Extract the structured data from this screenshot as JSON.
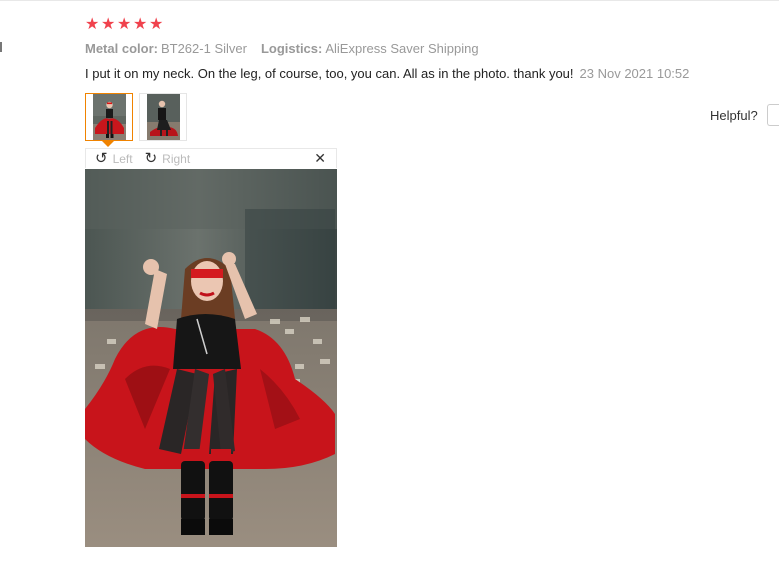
{
  "rating": {
    "stars": 5,
    "star_glyph": "★",
    "color": "#f0424d"
  },
  "meta": {
    "color_key": "Metal color:",
    "color_value": "BT262-1 Silver",
    "logistics_key": "Logistics:",
    "logistics_value": "AliExpress Saver Shipping"
  },
  "review": {
    "text": "I put it on my neck. On the leg, of course, too, you can. All as in the photo. thank you!",
    "date": "23 Nov 2021 10:52"
  },
  "helpful": {
    "label": "Helpful?"
  },
  "viewer": {
    "rotate_left": "Left",
    "rotate_right": "Right",
    "close_symbol": "✕",
    "rotate_left_icon": "↺",
    "rotate_right_icon": "↻"
  },
  "colors": {
    "accent": "#f08300",
    "star": "#f0424d"
  },
  "icons": [
    "rotate-left-icon",
    "rotate-right-icon",
    "close-icon",
    "star-icon"
  ]
}
